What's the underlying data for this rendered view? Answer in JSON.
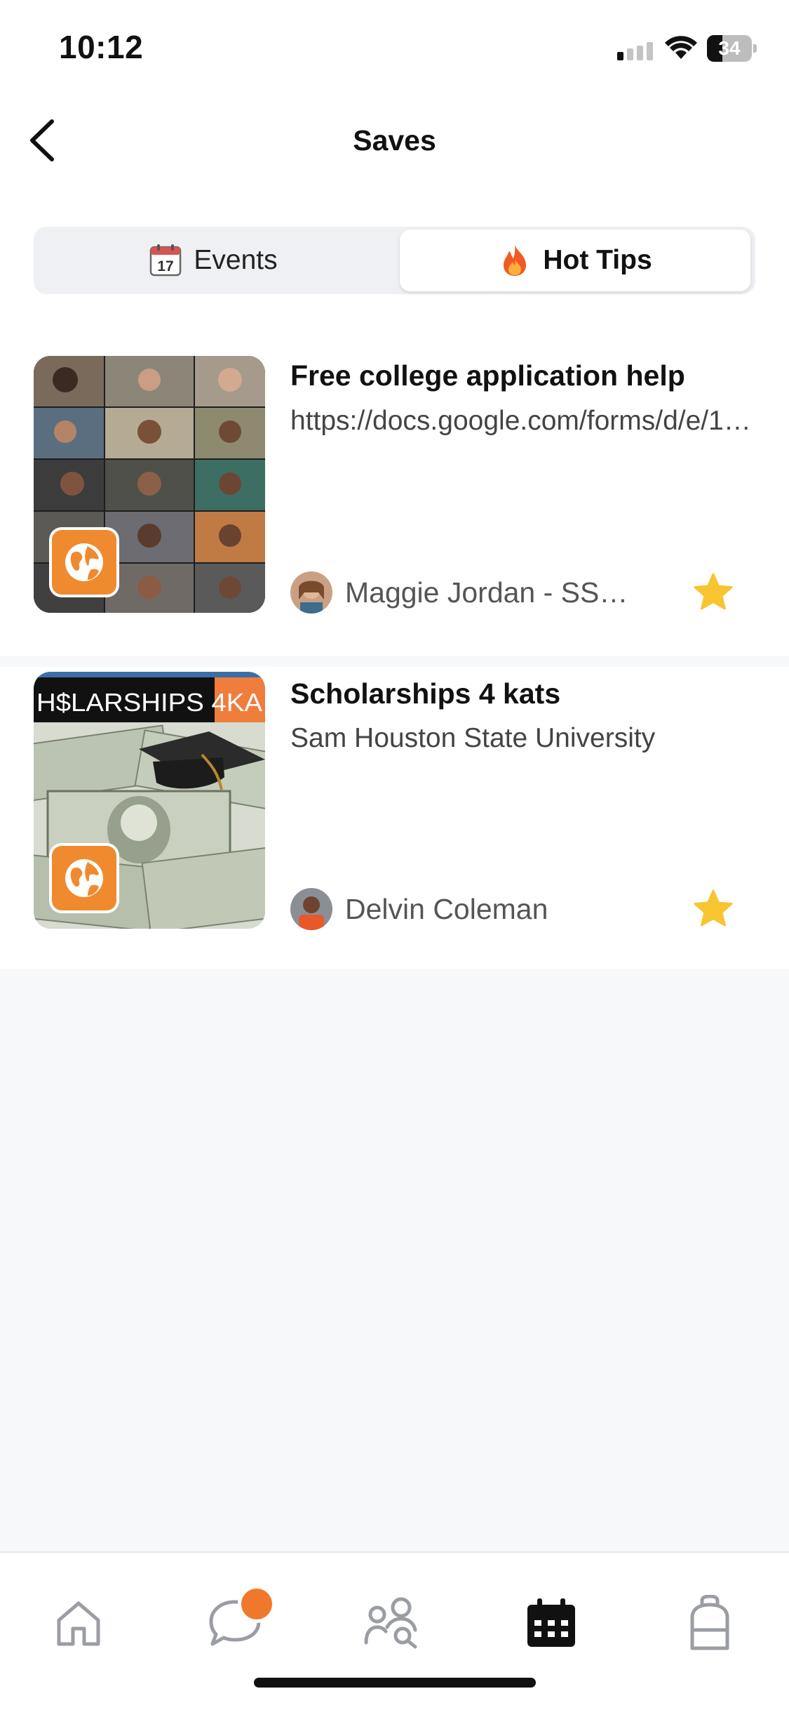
{
  "status_bar": {
    "time": "10:12",
    "battery": "34",
    "battery_level": 0.34
  },
  "header": {
    "title": "Saves"
  },
  "segmented": {
    "events_label": "Events",
    "hot_tips_label": "Hot Tips",
    "selected": "Hot Tips"
  },
  "saves": [
    {
      "title": "Free college application help",
      "subtitle": "https://docs.google.com/forms/d/e/1FAIpQLSf",
      "author": "Maggie Jordan - SSU Admissions",
      "starred": true
    },
    {
      "title": "Scholarships 4 kats",
      "subtitle": "Sam Houston State University",
      "author": "Delvin Coleman",
      "starred": true,
      "thumb_banner": "H$LARSHIPS 4KA"
    }
  ],
  "tab_bar": {
    "items": [
      {
        "icon": "home-icon"
      },
      {
        "icon": "chat-icon",
        "badge": true
      },
      {
        "icon": "people-search-icon"
      },
      {
        "icon": "calendar-icon",
        "active": true
      },
      {
        "icon": "backpack-icon"
      }
    ]
  },
  "colors": {
    "accent": "#f0782a",
    "star": "#f7c531",
    "active_tab": "#111111",
    "inactive_tab": "#9a9da3"
  }
}
